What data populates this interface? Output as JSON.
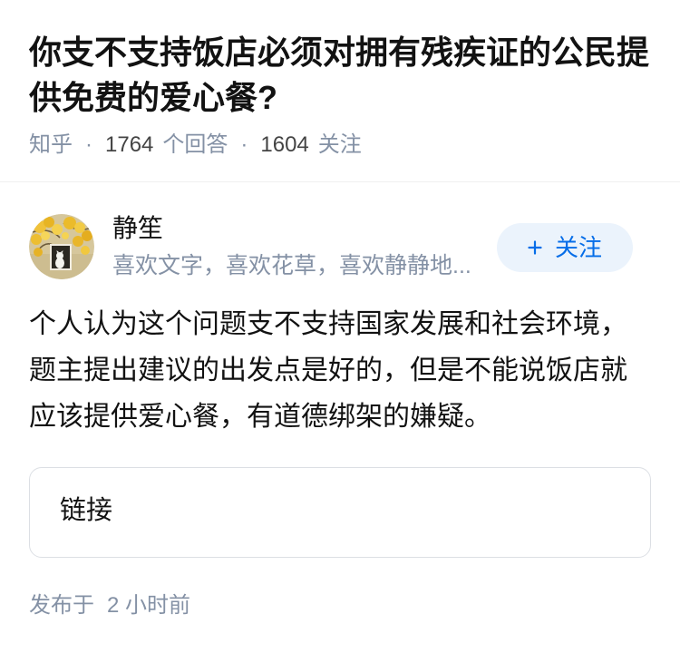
{
  "question": {
    "title": "你支不支持饭店必须对拥有残疾证的公民提供免费的爱心餐?",
    "source": "知乎",
    "separator": "·",
    "answer_count": "1764",
    "answer_count_label": "个回答",
    "follower_count": "1604",
    "follower_count_label": "关注"
  },
  "answer": {
    "author": {
      "name": "静笙",
      "bio": "喜欢文字，喜欢花草，喜欢静静地...",
      "avatar_icon": "avatar-image"
    },
    "follow_button": {
      "icon": "plus-icon",
      "label": "关注"
    },
    "content": "个人认为这个问题支不支持国家发展和社会环境，题主提出建议的出发点是好的，但是不能说饭店就应该提供爱心餐，有道德绑架的嫌疑。",
    "link_card": {
      "label": "链接"
    },
    "published": {
      "label": "发布于",
      "time": "2 小时前"
    }
  },
  "colors": {
    "text_primary": "#121212",
    "text_secondary": "#8491a5",
    "count_text": "#444444",
    "brand_blue": "#056de8",
    "follow_button_bg": "#ebf3fc",
    "card_border": "#dcdfe4",
    "divider": "#f0f0f0"
  }
}
